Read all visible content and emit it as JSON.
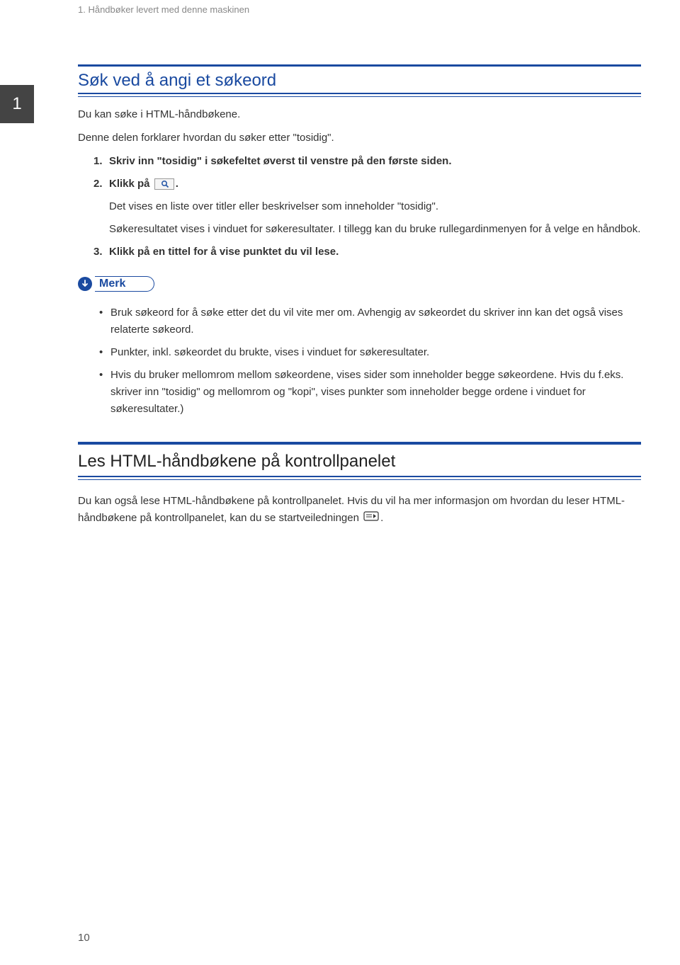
{
  "running_head": "1. Håndbøker levert med denne maskinen",
  "tab_marker": "1",
  "section1": {
    "heading": "Søk ved å angi et søkeord",
    "intro1": "Du kan søke i HTML-håndbøkene.",
    "intro2": "Denne delen forklarer hvordan du søker etter \"tosidig\".",
    "step1": "Skriv inn \"tosidig\" i søkefeltet øverst til venstre på den første siden.",
    "step2_prefix": "Klikk på ",
    "step2_suffix": ".",
    "step2_note1": "Det vises en liste over titler eller beskrivelser som inneholder \"tosidig\".",
    "step2_note2": "Søkeresultatet vises i vinduet for søkeresultater. I tillegg kan du bruke rullegardinmenyen for å velge en håndbok.",
    "step3": "Klikk på en tittel for å vise punktet du vil lese."
  },
  "note": {
    "label": "Merk",
    "items": [
      "Bruk søkeord for å søke etter det du vil vite mer om. Avhengig av søkeordet du skriver inn kan det også vises relaterte søkeord.",
      "Punkter, inkl. søkeordet du brukte, vises i vinduet for søkeresultater.",
      "Hvis du bruker mellomrom mellom søkeordene, vises sider som inneholder begge søkeordene. Hvis du f.eks. skriver inn \"tosidig\" og mellomrom og \"kopi\", vises punkter som inneholder begge ordene i vinduet for søkeresultater.)"
    ]
  },
  "section2": {
    "heading": "Les HTML-håndbøkene på kontrollpanelet",
    "body_prefix": "Du kan også lese HTML-håndbøkene på kontrollpanelet. Hvis du vil ha mer informasjon om hvordan du leser HTML-håndbøkene på kontrollpanelet, kan du se startveiledningen ",
    "body_suffix": "."
  },
  "page_number": "10"
}
